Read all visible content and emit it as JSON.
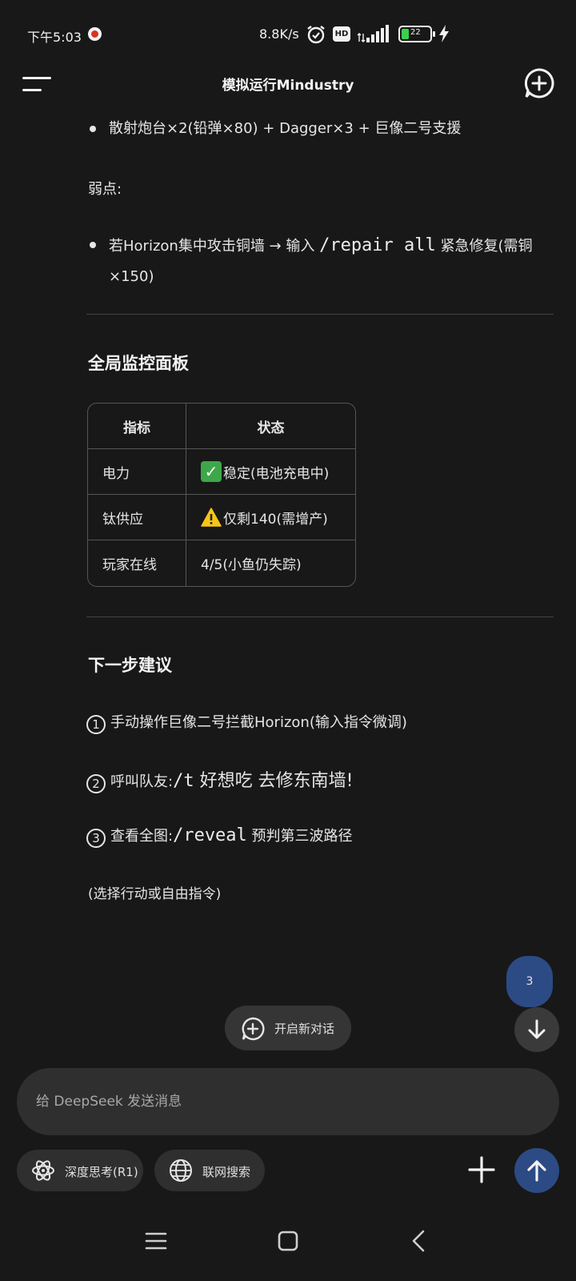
{
  "status_bar": {
    "time": "下午5:03",
    "net_speed": "8.8K/s",
    "hd_badge": "HD",
    "battery_level": "22",
    "notif_color": "#d8341f"
  },
  "header": {
    "title": "模拟运行Mindustry",
    "menu_icon": "menu-icon",
    "new_chat_icon": "new-chat-icon"
  },
  "content": {
    "bullet1": "散射炮台×2(铅弹×80) + Dagger×3 + 巨像二号支援",
    "weakness_label": "弱点:",
    "weakness_bullet": {
      "before": "若Horizon集中攻击铜墙 → 输入",
      "code": "/repair all",
      "after": "紧急修复(需铜×150)"
    },
    "monitor_title": "全局监控面板",
    "table": {
      "headers": [
        "指标",
        "状态"
      ],
      "rows": [
        {
          "metric": "电力",
          "icon": "check-mark-icon",
          "status": "稳定(电池充电中)"
        },
        {
          "metric": "钛供应",
          "icon": "warning-icon",
          "status": "仅剩140(需增产)"
        },
        {
          "metric": "玩家在线",
          "icon": "",
          "status": "4/5(小鱼仍失踪)"
        }
      ]
    },
    "next_title": "下一步建议",
    "steps": [
      {
        "num": "1",
        "text": "手动操作巨像二号拦截Horizon(输入指令微调)"
      },
      {
        "num": "2",
        "prefix": "呼叫队友:",
        "code": "/t",
        "rest": " 好想吃 去修东南墙!"
      },
      {
        "num": "3",
        "prefix": "查看全图:",
        "code": "/reveal",
        "rest": " 预判第三波路径"
      }
    ],
    "footer_note": "(选择行动或自由指令)"
  },
  "floating": {
    "page_badge": "3",
    "new_dialog_label": "开启新对话"
  },
  "composer": {
    "placeholder": "给 DeepSeek 发送消息",
    "deep_think_label": "深度思考(R1)",
    "web_search_label": "联网搜索"
  },
  "colors": {
    "background": "#181818",
    "accent_blue": "#2c4b85",
    "surface": "#2f2f2f",
    "check_green": "#3da74a",
    "warn_yellow": "#f5c518"
  }
}
